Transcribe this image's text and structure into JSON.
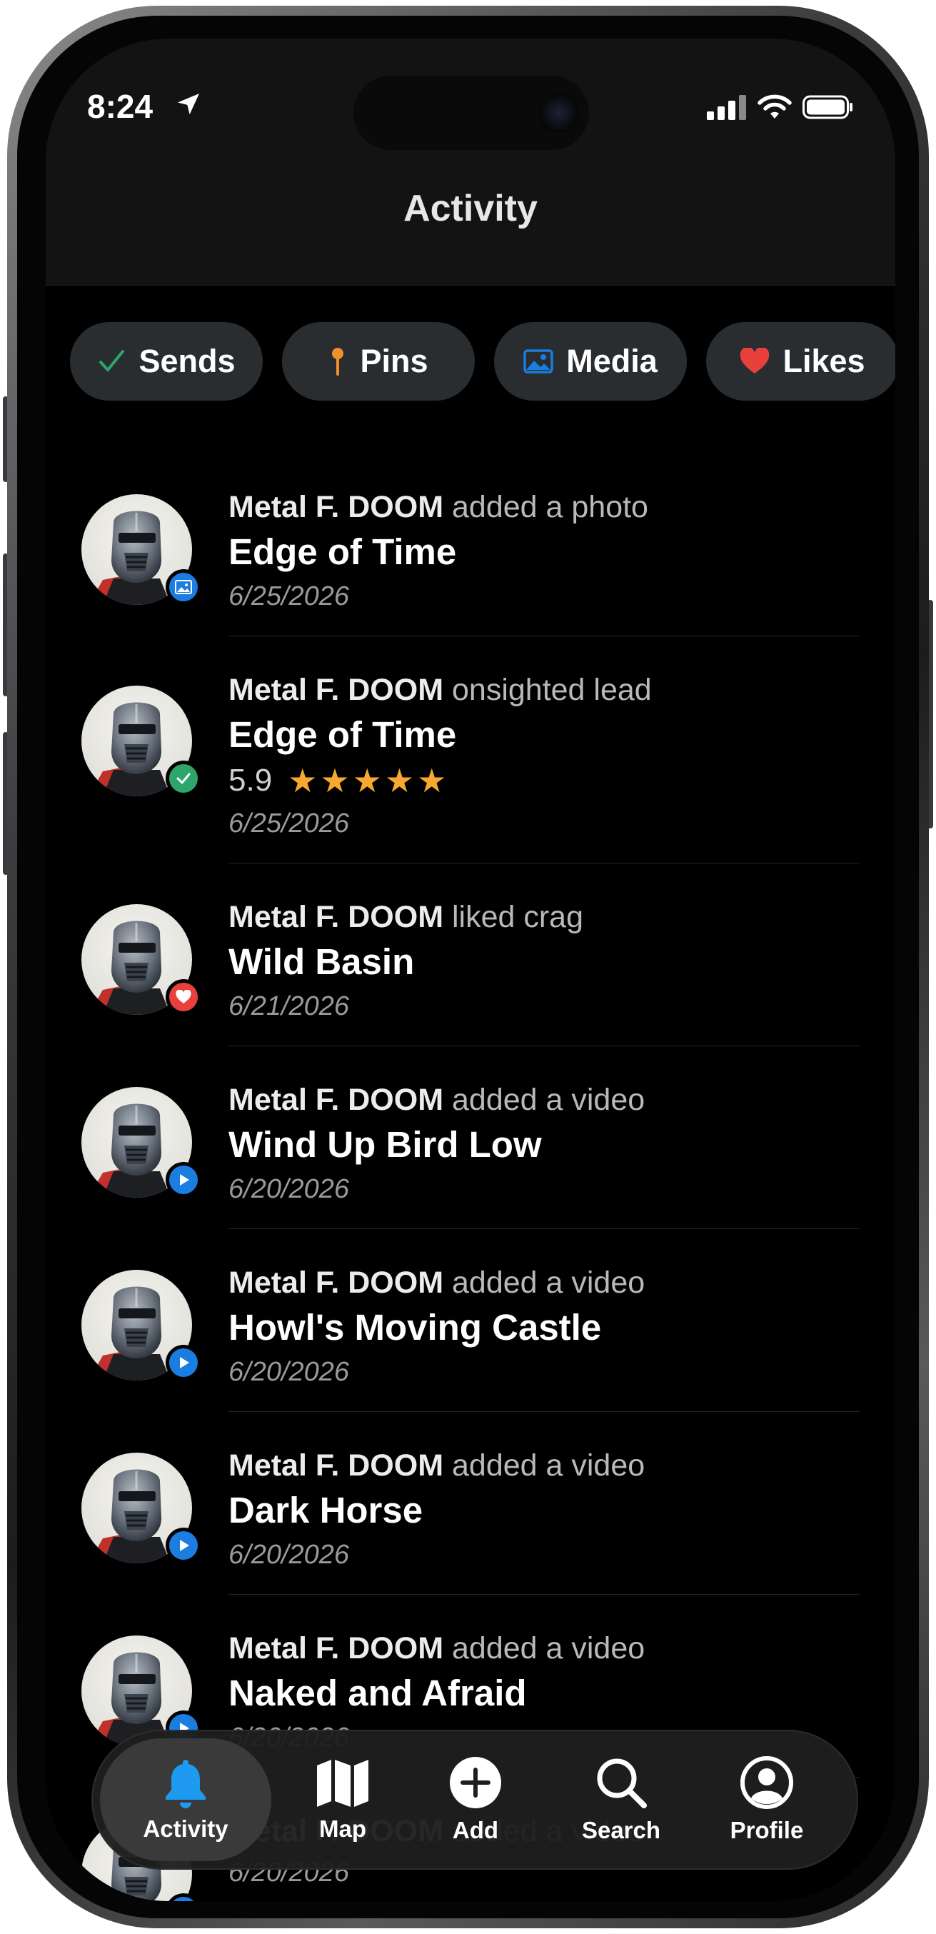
{
  "status_bar": {
    "time": "8:24"
  },
  "header": {
    "title": "Activity"
  },
  "filters": [
    {
      "label": "Sends",
      "icon": "check-icon",
      "color": "#2ea56b"
    },
    {
      "label": "Pins",
      "icon": "pin-icon",
      "color": "#f0902a"
    },
    {
      "label": "Media",
      "icon": "image-icon",
      "color": "#1a7de0"
    },
    {
      "label": "Likes",
      "icon": "heart-icon",
      "color": "#e8403d"
    }
  ],
  "feed": [
    {
      "user": "Metal F. DOOM",
      "action": "added a photo",
      "title": "Edge of Time",
      "date": "6/25/2026",
      "badge": "photo"
    },
    {
      "user": "Metal F. DOOM",
      "action": "onsighted lead",
      "title": "Edge of Time",
      "grade": "5.9",
      "stars": "★★★★★",
      "date": "6/25/2026",
      "badge": "check"
    },
    {
      "user": "Metal F. DOOM",
      "action": "liked crag",
      "title": "Wild Basin",
      "date": "6/21/2026",
      "badge": "heart"
    },
    {
      "user": "Metal F. DOOM",
      "action": "added a video",
      "title": "Wind Up Bird Low",
      "date": "6/20/2026",
      "badge": "video"
    },
    {
      "user": "Metal F. DOOM",
      "action": "added a video",
      "title": "Howl's Moving Castle",
      "date": "6/20/2026",
      "badge": "video"
    },
    {
      "user": "Metal F. DOOM",
      "action": "added a video",
      "title": "Dark Horse",
      "date": "6/20/2026",
      "badge": "video"
    },
    {
      "user": "Metal F. DOOM",
      "action": "added a video",
      "title": "Naked and Afraid",
      "date": "6/20/2026",
      "badge": "video"
    },
    {
      "user": "Metal F. DOOM",
      "action": "added a video",
      "title": "",
      "date": "6/20/2026",
      "badge": "video"
    }
  ],
  "tabbar": [
    {
      "label": "Activity",
      "icon": "bell-icon",
      "active": true
    },
    {
      "label": "Map",
      "icon": "map-icon",
      "active": false
    },
    {
      "label": "Add",
      "icon": "plus-circle-icon",
      "active": false
    },
    {
      "label": "Search",
      "icon": "search-icon",
      "active": false
    },
    {
      "label": "Profile",
      "icon": "profile-icon",
      "active": false
    }
  ],
  "colors": {
    "accent": "#1e9bf0",
    "stars": "#f7a830",
    "background": "#000000",
    "chip_bg": "#2a2d30"
  }
}
